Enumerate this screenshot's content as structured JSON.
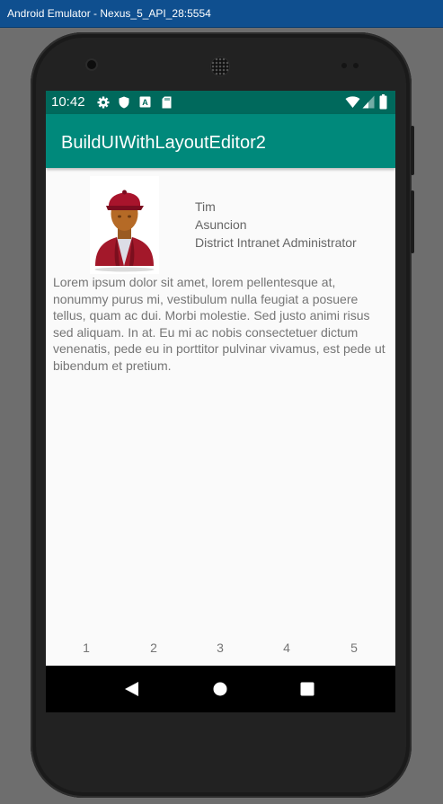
{
  "window": {
    "title": "Android Emulator - Nexus_5_API_28:5554"
  },
  "status_bar": {
    "time": "10:42",
    "left_icons": [
      "gear-icon",
      "shield-icon",
      "a-badge-icon",
      "sd-card-icon"
    ],
    "right_icons": [
      "wifi-icon",
      "cellular-icon",
      "battery-icon"
    ]
  },
  "app_bar": {
    "title": "BuildUIWithLayoutEditor2"
  },
  "profile": {
    "first_name": "Tim",
    "last_name": "Asuncion",
    "job_title": "District Intranet Administrator"
  },
  "body_text": "Lorem ipsum dolor sit amet, lorem pellentesque at, nonummy purus mi, vestibulum nulla feugiat a posuere tellus, quam ac dui. Morbi molestie. Sed justo animi risus sed aliquam. In at. Eu mi ac nobis consectetuer dictum venenatis, pede eu in porttitor pulvinar vivamus, est pede ut bibendum et pretium.",
  "bottom_numbers": [
    "1",
    "2",
    "3",
    "4",
    "5"
  ],
  "nav_bar": {
    "buttons": [
      "back-icon",
      "home-icon",
      "recents-icon"
    ]
  },
  "colors": {
    "status_bar": "#00695c",
    "app_bar": "#00897b",
    "window_titlebar": "#0f4f8f"
  }
}
